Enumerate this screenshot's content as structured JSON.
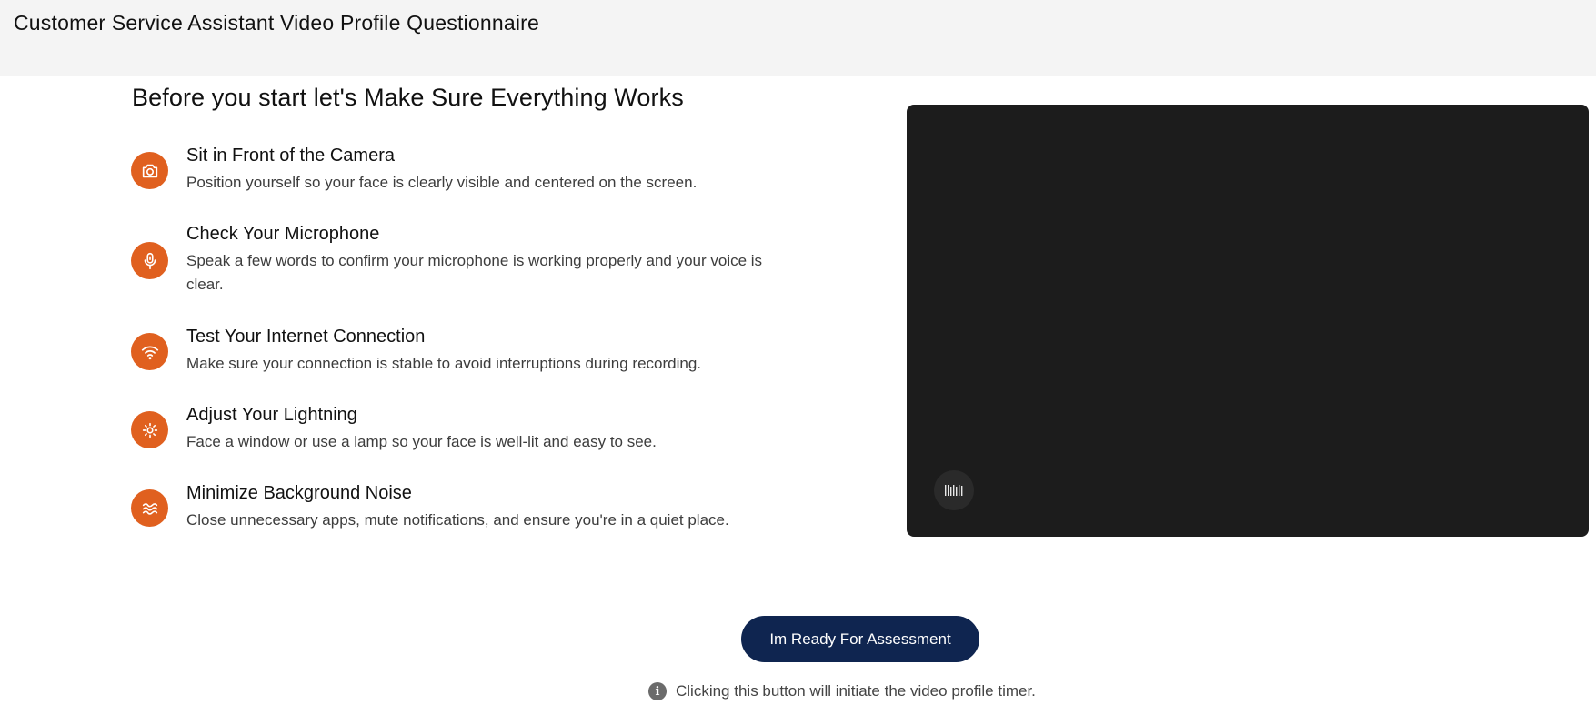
{
  "header": {
    "title": "Customer Service Assistant Video Profile Questionnaire"
  },
  "main": {
    "heading": "Before you start let's Make Sure Everything Works",
    "checklist": [
      {
        "icon": "camera-icon",
        "title": "Sit in Front of the Camera",
        "description": "Position yourself so your face is clearly visible and centered on the screen."
      },
      {
        "icon": "microphone-icon",
        "title": "Check Your Microphone",
        "description": "Speak a few words to confirm your microphone is working properly and your voice is clear."
      },
      {
        "icon": "wifi-icon",
        "title": "Test Your Internet Connection",
        "description": "Make sure your connection is stable to avoid interruptions during recording."
      },
      {
        "icon": "sun-icon",
        "title": "Adjust Your Lightning",
        "description": "Face a window or use a lamp so your face is well-lit and easy to see."
      },
      {
        "icon": "waves-icon",
        "title": "Minimize Background Noise",
        "description": "Close unnecessary apps, mute notifications, and ensure you're in a quiet place."
      }
    ]
  },
  "video": {
    "indicator_icon": "audio-level-icon"
  },
  "actions": {
    "ready_label": "Im Ready For Assessment",
    "notice": "Clicking this button will initiate the video profile timer.",
    "notice_icon": "info-icon"
  },
  "colors": {
    "accent": "#e0601f",
    "button": "#0f2550",
    "video_bg": "#1c1c1c",
    "header_bg": "#f4f4f4"
  }
}
